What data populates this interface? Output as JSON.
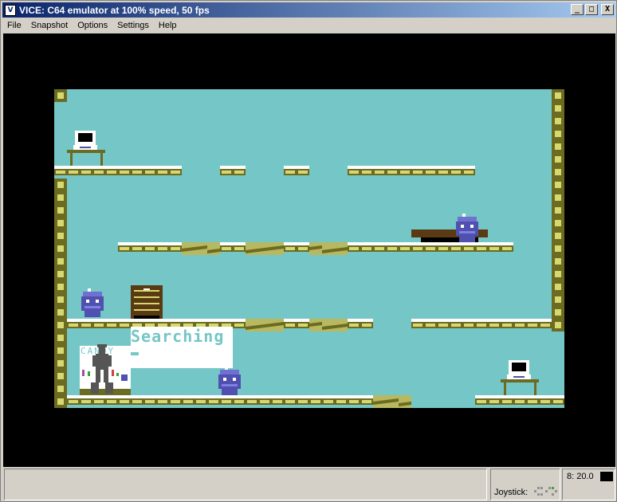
{
  "window": {
    "title": "VICE: C64 emulator at 100% speed, 50 fps",
    "buttons": {
      "minimize": "_",
      "maximize": "□",
      "close": "X"
    }
  },
  "menu": [
    {
      "label": "File"
    },
    {
      "label": "Snapshot"
    },
    {
      "label": "Options"
    },
    {
      "label": "Settings"
    },
    {
      "label": "Help"
    }
  ],
  "game": {
    "searching_label": "Searching",
    "candy_label": "CANDY",
    "colors": {
      "sky": "#75c6c6",
      "floor_dark": "#6b6b21",
      "floor_light": "#ffffff",
      "wall": "#6b6b21",
      "robot": "#5050b0",
      "furniture": "#5a3a12"
    }
  },
  "status": {
    "joystick_label": "Joystick:",
    "drive_label": "8: 20.0"
  }
}
